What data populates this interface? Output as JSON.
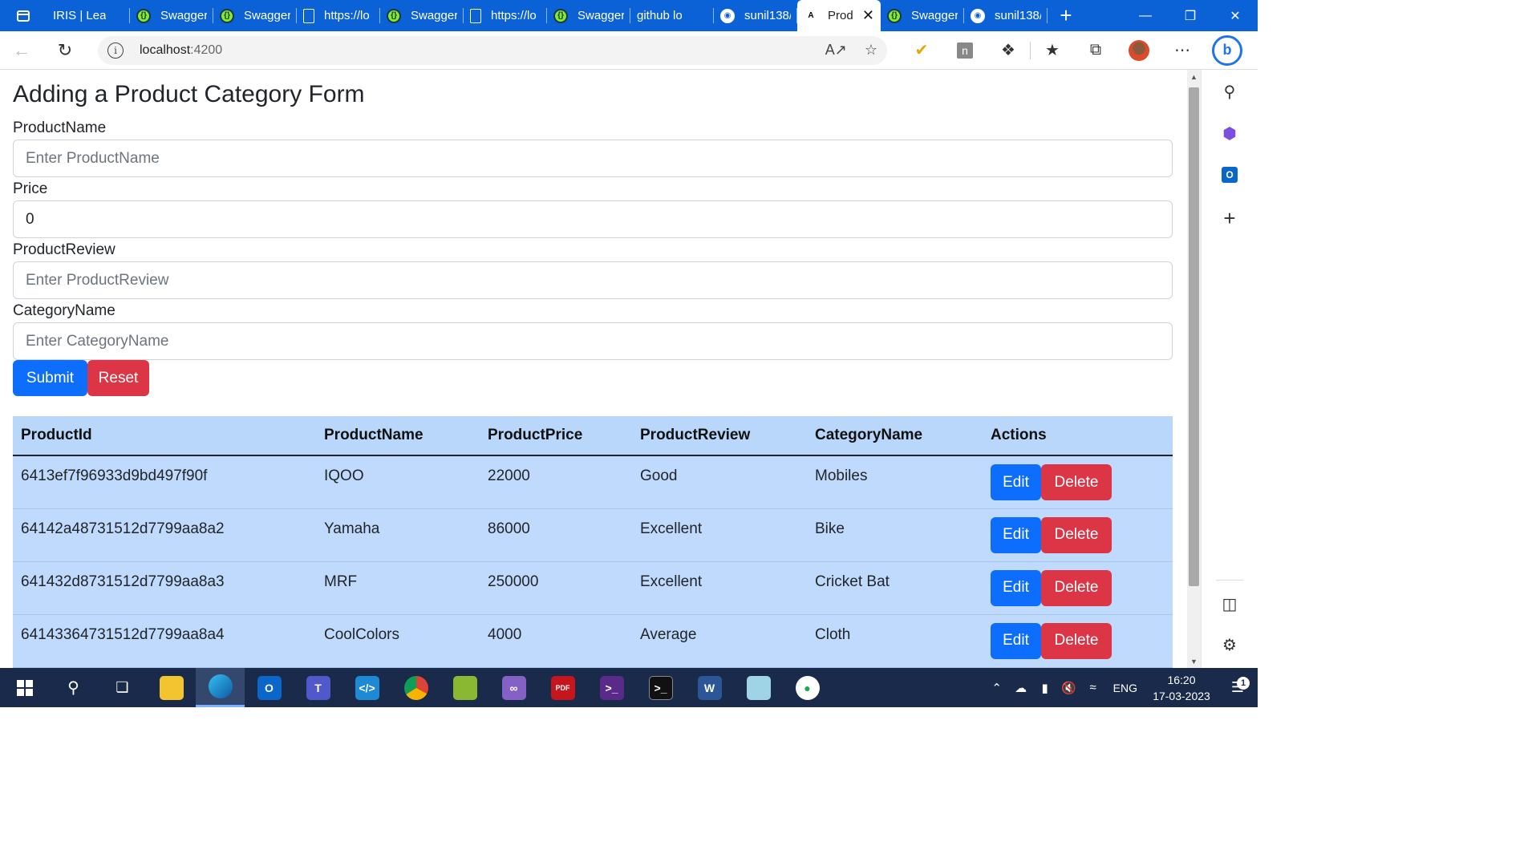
{
  "browser": {
    "tabs": [
      {
        "label": "IRIS | Lea",
        "icon": "none"
      },
      {
        "label": "Swagger",
        "icon": "swagger"
      },
      {
        "label": "Swagger",
        "icon": "swagger"
      },
      {
        "label": "https://lo",
        "icon": "doc"
      },
      {
        "label": "Swagger",
        "icon": "swagger"
      },
      {
        "label": "https://lo",
        "icon": "doc"
      },
      {
        "label": "Swagger",
        "icon": "swagger"
      },
      {
        "label": "github lo",
        "icon": "none"
      },
      {
        "label": "sunil138/",
        "icon": "github"
      },
      {
        "label": "Prod",
        "icon": "angular"
      },
      {
        "label": "Swagger",
        "icon": "swagger"
      },
      {
        "label": "sunil138/",
        "icon": "github"
      }
    ],
    "active_tab_index": 9,
    "url_host": "localhost",
    "url_port": ":4200"
  },
  "form": {
    "title": "Adding a Product Category Form",
    "fields": {
      "product_name": {
        "label": "ProductName",
        "placeholder": "Enter ProductName",
        "value": ""
      },
      "price": {
        "label": "Price",
        "placeholder": "",
        "value": "0"
      },
      "product_review": {
        "label": "ProductReview",
        "placeholder": "Enter ProductReview",
        "value": ""
      },
      "category_name": {
        "label": "CategoryName",
        "placeholder": "Enter CategoryName",
        "value": ""
      }
    },
    "submit_label": "Submit",
    "reset_label": "Reset"
  },
  "table": {
    "headers": [
      "ProductId",
      "ProductName",
      "ProductPrice",
      "ProductReview",
      "CategoryName",
      "Actions"
    ],
    "rows": [
      {
        "id": "6413ef7f96933d9bd497f90f",
        "name": "IQOO",
        "price": "22000",
        "review": "Good",
        "category": "Mobiles"
      },
      {
        "id": "64142a48731512d7799aa8a2",
        "name": "Yamaha",
        "price": "86000",
        "review": "Excellent",
        "category": "Bike"
      },
      {
        "id": "641432d8731512d7799aa8a3",
        "name": "MRF",
        "price": "250000",
        "review": "Excellent",
        "category": "Cricket Bat"
      },
      {
        "id": "64143364731512d7799aa8a4",
        "name": "CoolColors",
        "price": "4000",
        "review": "Average",
        "category": "Cloth"
      }
    ],
    "edit_label": "Edit",
    "delete_label": "Delete"
  },
  "taskbar": {
    "language": "ENG",
    "time": "16:20",
    "date": "17-03-2023",
    "notification_count": "1"
  },
  "colors": {
    "tabbar": "#0a62d6",
    "primary": "#0d6efd",
    "danger": "#dc3545",
    "table_row": "#bfdafc",
    "taskbar": "#1a2a4a"
  }
}
